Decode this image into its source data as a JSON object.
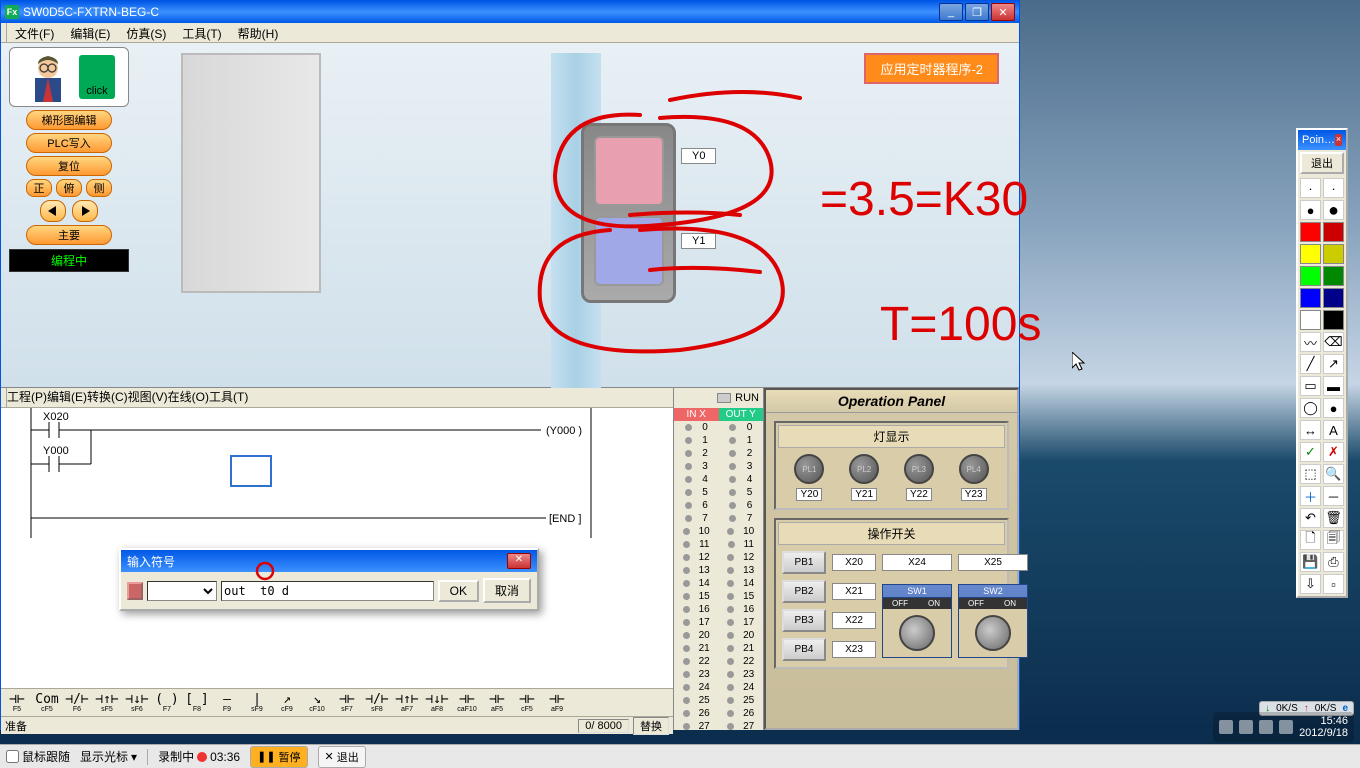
{
  "window": {
    "title": "SW0D5C-FXTRN-BEG-C"
  },
  "menu": {
    "file": "文件(F)",
    "edit": "编辑(E)",
    "sim": "仿真(S)",
    "tool": "工具(T)",
    "help": "帮助(H)"
  },
  "sim": {
    "badge": "应用定时器程序-2",
    "io_y0": "Y0",
    "io_y1": "Y1"
  },
  "left_panel": {
    "click": "click",
    "btn_ladder": "梯形图编辑",
    "btn_write": "PLC写入",
    "btn_reset": "复位",
    "btn_front": "正",
    "btn_top": "俯",
    "btn_side": "侧",
    "btn_main": "主要",
    "status": "编程中"
  },
  "ladder_menu": {
    "project": "工程(P)",
    "edit": "编辑(E)",
    "convert": "转换(C)",
    "view": "视图(V)",
    "online": "在线(O)",
    "tool": "工具(T)"
  },
  "ladder": {
    "x020": "X020",
    "y000": "Y000",
    "out_y000": "(Y000  )",
    "end": "[END  ]",
    "pos": "0/  8000",
    "replace": "替换",
    "ready": "准备"
  },
  "dialog": {
    "title": "输入符号",
    "value": "out  t0 d",
    "ok": "OK",
    "cancel": "取消"
  },
  "io": {
    "run": "RUN",
    "in_hdr": "IN  X",
    "out_hdr": "OUT Y"
  },
  "op_panel": {
    "title": "Operation Panel",
    "lamps_hdr": "灯显示",
    "lamps": [
      {
        "name": "PL1",
        "y": "Y20"
      },
      {
        "name": "PL2",
        "y": "Y21"
      },
      {
        "name": "PL3",
        "y": "Y22"
      },
      {
        "name": "PL4",
        "y": "Y23"
      }
    ],
    "switch_hdr": "操作开关",
    "pb1": "PB1",
    "pb2": "PB2",
    "pb3": "PB3",
    "pb4": "PB4",
    "x20": "X20",
    "x21": "X21",
    "x22": "X22",
    "x23": "X23",
    "x24": "X24",
    "x25": "X25",
    "sw1": "SW1",
    "sw2": "SW2",
    "off": "OFF",
    "on": "ON"
  },
  "toolbar": [
    {
      "sym": "⊣⊢",
      "key": "F5"
    },
    {
      "sym": "Com",
      "key": "cF5"
    },
    {
      "sym": "⊣/⊢",
      "key": "F6"
    },
    {
      "sym": "⊣↑⊢",
      "key": "sF5"
    },
    {
      "sym": "⊣↓⊢",
      "key": "sF6"
    },
    {
      "sym": "( )",
      "key": "F7"
    },
    {
      "sym": "[ ]",
      "key": "F8"
    },
    {
      "sym": "—",
      "key": "F9"
    },
    {
      "sym": "|",
      "key": "sF9"
    },
    {
      "sym": "↗",
      "key": "cF9"
    },
    {
      "sym": "↘",
      "key": "cF10"
    },
    {
      "sym": "⊣⊢",
      "key": "sF7"
    },
    {
      "sym": "⊣/⊢",
      "key": "sF8"
    },
    {
      "sym": "⊣↑⊢",
      "key": "aF7"
    },
    {
      "sym": "⊣↓⊢",
      "key": "aF8"
    },
    {
      "sym": "⊣⊢",
      "key": "caF10"
    },
    {
      "sym": "⊣⊢",
      "key": "aF5"
    },
    {
      "sym": "⊣⊢",
      "key": "cF5"
    },
    {
      "sym": "⊣⊢",
      "key": "aF9"
    }
  ],
  "pointer": {
    "title": "Poin…",
    "exit": "退出"
  },
  "annotations": {
    "eq1": "=3.5=K30",
    "eq2": "T=100s"
  },
  "recorder": {
    "mouse_follow": "鼠标跟随",
    "show_cursor": "显示光标",
    "recording": "录制中",
    "time": "03:36",
    "pause": "暂停",
    "exit": "退出"
  },
  "net": {
    "down": "0K/S",
    "up": "0K/S"
  },
  "clock": {
    "time": "15:46",
    "date": "2012/9/18"
  }
}
